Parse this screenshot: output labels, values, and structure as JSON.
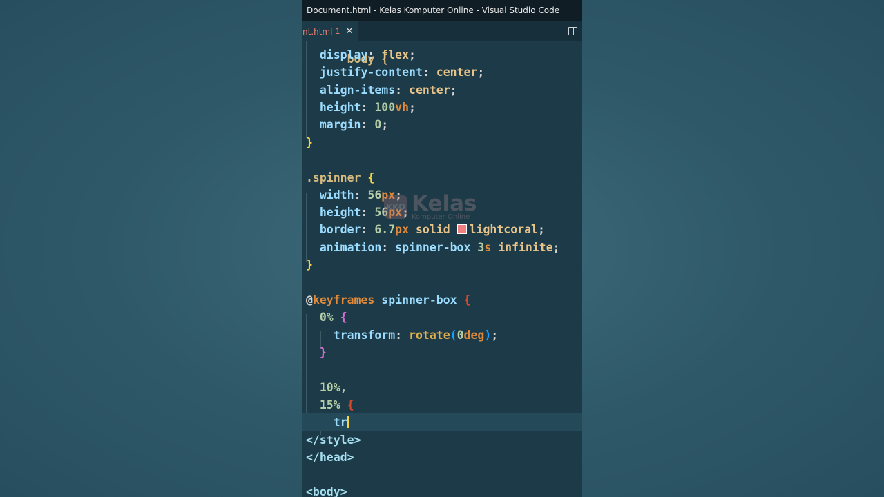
{
  "window": {
    "title": "Document.html - Kelas Komputer Online - Visual Studio Code"
  },
  "tab": {
    "label": "nt.html",
    "problem_count": "1",
    "close_glyph": "✕"
  },
  "watermark": {
    "logo_text": "KKO",
    "brand": "Kelas",
    "subtitle": "Komputer Online"
  },
  "code": {
    "l0": "body {",
    "l1_prop": "display",
    "l1_val": "flex",
    "l2_prop": "justify-content",
    "l2_val": "center",
    "l3_prop": "align-items",
    "l3_val": "center",
    "l4_prop": "height",
    "l4_num": "100",
    "l4_unit": "vh",
    "l5_prop": "margin",
    "l5_num": "0",
    "l6": "}",
    "l8_sel": ".spinner",
    "l8_brace": "{",
    "l9_prop": "width",
    "l9_num": "56",
    "l9_unit": "px",
    "l10_prop": "height",
    "l10_num": "56",
    "l10_unit": "px",
    "l11_prop": "border",
    "l11_num": "6.7",
    "l11_unit": "px",
    "l11_style": "solid",
    "l11_color": "lightcoral",
    "l12_prop": "animation",
    "l12_name": "spinner-box",
    "l12_num": "3",
    "l12_unit": "s",
    "l12_iter": "infinite",
    "l13": "}",
    "l15_at": "@",
    "l15_kw": "keyframes",
    "l15_name": "spinner-box",
    "l15_brace": "{",
    "l16_pct": "0%",
    "l16_brace": "{",
    "l17_prop": "transform",
    "l17_fn": "rotate",
    "l17_open": "(",
    "l17_num": "0",
    "l17_unit": "deg",
    "l17_close": ")",
    "l18_brace": "}",
    "l20_pct": "10%,",
    "l21_pct": "15%",
    "l21_brace": "{",
    "l22_text": "tr",
    "l23": "</style>",
    "l24": "</head>",
    "l26": "<body>"
  },
  "colors": {
    "swatch": "#f08080",
    "editor_bg": "#1c3a47",
    "titlebar_bg": "#111d24"
  }
}
